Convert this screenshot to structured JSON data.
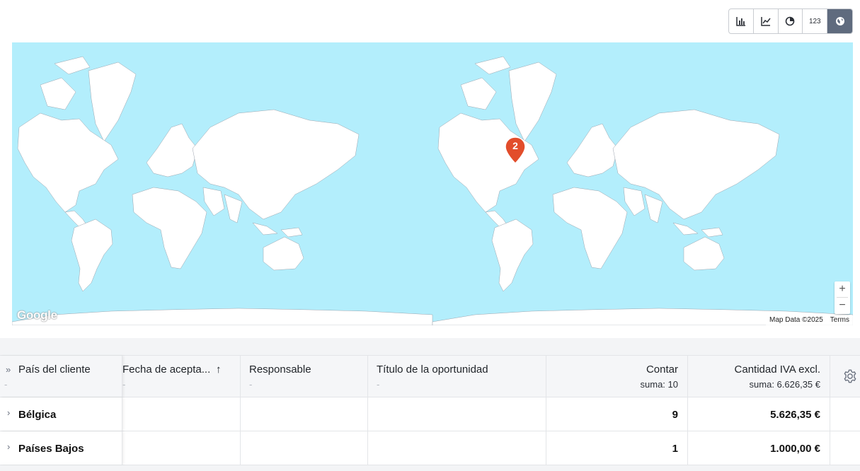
{
  "view_switcher": {
    "buttons": [
      {
        "name": "bar-chart",
        "label": ""
      },
      {
        "name": "line-chart",
        "label": ""
      },
      {
        "name": "pie-chart",
        "label": ""
      },
      {
        "name": "number",
        "label": "123"
      },
      {
        "name": "map",
        "label": ""
      }
    ],
    "active": "map"
  },
  "map": {
    "marker_count": "2",
    "marker_color": "#e24d2b",
    "water_color": "#b3eefc",
    "land_color": "#ffffff",
    "zoom_in": "+",
    "zoom_out": "−",
    "logo": "Google",
    "map_data": "Map Data ©2025",
    "terms": "Terms"
  },
  "table": {
    "columns": [
      {
        "title": "País del cliente",
        "sub": "-"
      },
      {
        "title": "Fecha de acepta...",
        "sort": "↑",
        "sub": "-"
      },
      {
        "title": "Responsable",
        "sub": "-"
      },
      {
        "title": "Título de la oportunidad",
        "sub": "-"
      },
      {
        "title": "Contar",
        "sub": "suma: 10"
      },
      {
        "title": "Cantidad IVA excl.",
        "sub": "suma: 6.626,35 €"
      }
    ],
    "rows": [
      {
        "country": "Bélgica",
        "count": "9",
        "amount": "5.626,35 €"
      },
      {
        "country": "Países Bajos",
        "count": "1",
        "amount": "1.000,00 €"
      }
    ],
    "expand_all": "»",
    "expand_row": "›"
  }
}
